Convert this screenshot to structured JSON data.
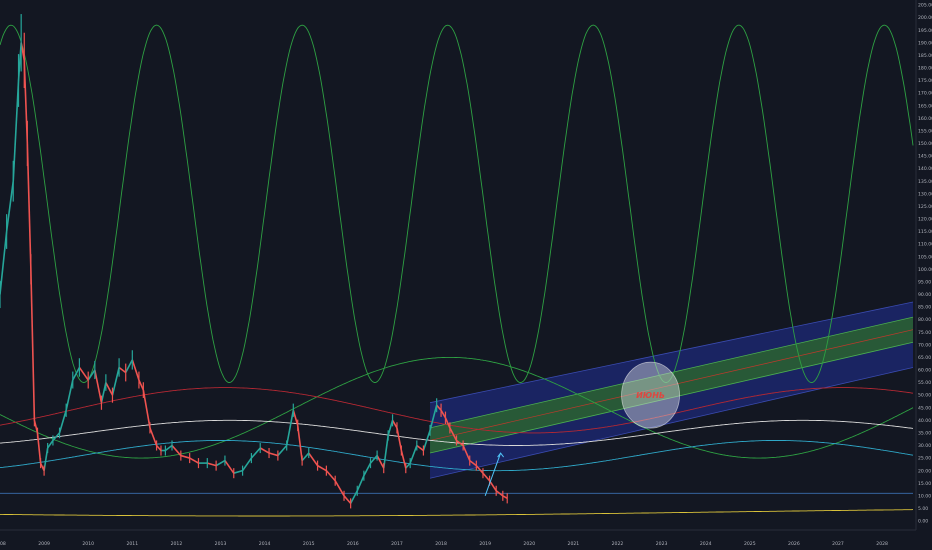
{
  "chart_data": {
    "type": "line",
    "title": "",
    "xlabel": "",
    "ylabel": "",
    "xlim": [
      2008.0,
      2028.7
    ],
    "ylim": [
      0,
      205
    ],
    "grid": false,
    "legend": "none",
    "x_ticks": [
      "2008",
      "2009",
      "2010",
      "2011",
      "2012",
      "2013",
      "2014",
      "2015",
      "2016",
      "2017",
      "2018",
      "2019",
      "2020",
      "2021",
      "2022",
      "2023",
      "2024",
      "2025",
      "2026",
      "2027",
      "2028"
    ],
    "y_ticks": [
      "0.00",
      "5.00",
      "10.00",
      "15.00",
      "20.00",
      "25.00",
      "30.00",
      "35.00",
      "40.00",
      "45.00",
      "50.00",
      "55.00",
      "60.00",
      "65.00",
      "70.00",
      "75.00",
      "80.00",
      "85.00",
      "90.00",
      "95.00",
      "100.00",
      "105.00",
      "110.00",
      "115.00",
      "120.00",
      "125.00",
      "130.00",
      "135.00",
      "140.00",
      "145.00",
      "150.00",
      "155.00",
      "160.00",
      "165.00",
      "170.00",
      "175.00",
      "180.00",
      "185.00",
      "190.00",
      "195.00",
      "200.00",
      "205.00"
    ],
    "price_series": {
      "x": [
        2008.0,
        2008.15,
        2008.3,
        2008.42,
        2008.48,
        2008.55,
        2008.62,
        2008.7,
        2008.78,
        2008.85,
        2008.92,
        2009.0,
        2009.08,
        2009.2,
        2009.35,
        2009.5,
        2009.65,
        2009.8,
        2010.0,
        2010.15,
        2010.3,
        2010.4,
        2010.55,
        2010.7,
        2010.85,
        2011.0,
        2011.15,
        2011.25,
        2011.4,
        2011.55,
        2011.65,
        2011.75,
        2011.9,
        2012.1,
        2012.3,
        2012.5,
        2012.7,
        2012.9,
        2013.1,
        2013.3,
        2013.5,
        2013.7,
        2013.9,
        2014.1,
        2014.3,
        2014.5,
        2014.65,
        2014.75,
        2014.85,
        2015.0,
        2015.2,
        2015.4,
        2015.6,
        2015.8,
        2015.95,
        2016.1,
        2016.25,
        2016.4,
        2016.55,
        2016.7,
        2016.8,
        2016.9,
        2017.0,
        2017.1,
        2017.2,
        2017.3,
        2017.45,
        2017.6,
        2017.75,
        2017.9,
        2018.0,
        2018.1,
        2018.2,
        2018.35,
        2018.5,
        2018.65,
        2018.8,
        2018.95,
        2019.1,
        2019.25,
        2019.4,
        2019.5
      ],
      "y": [
        90,
        115,
        135,
        175,
        190,
        183,
        150,
        100,
        40,
        35,
        23,
        20,
        29,
        32,
        35,
        44,
        56,
        61,
        56,
        60,
        47,
        55,
        50,
        61,
        59,
        64,
        56,
        52,
        37,
        30,
        28,
        28,
        30,
        26,
        25,
        23,
        23,
        22,
        24,
        19,
        20,
        25,
        29,
        27,
        26,
        30,
        44,
        38,
        24,
        27,
        22,
        20,
        16,
        10,
        7,
        12,
        18,
        23,
        26,
        21,
        34,
        40,
        37,
        28,
        21,
        23,
        30,
        28,
        36,
        46,
        44,
        41,
        37,
        32,
        30,
        24,
        22,
        19,
        16,
        12,
        10,
        9
      ]
    },
    "projection_arrow": {
      "x": [
        2019.0,
        2019.35
      ],
      "y": [
        10,
        27
      ]
    },
    "curves": [
      {
        "name": "",
        "color": "#2ea043",
        "kind": "sine",
        "mid": 126,
        "amp": 71,
        "period": 3.3,
        "peak_x": 2008.25
      },
      {
        "name": "",
        "color": "#2ea043",
        "kind": "sine",
        "mid": 45,
        "amp": 20,
        "period": 14.0,
        "peak_x": 2018.2
      },
      {
        "name": "",
        "color": "#b22833",
        "kind": "sine",
        "mid": 44,
        "amp": 9,
        "period": 14.0,
        "peak_x": 2013.1
      },
      {
        "name": "",
        "color": "#2fa8c8",
        "kind": "sine",
        "mid": 26,
        "amp": 6,
        "period": 12.6,
        "peak_x": 2013.0
      },
      {
        "name": "",
        "color": "#d8d8d8",
        "kind": "sine",
        "mid": 35,
        "amp": 5,
        "period": 13.0,
        "peak_x": 2013.2
      },
      {
        "name": "",
        "color": "#d9c23a",
        "kind": "sine",
        "mid": 3.5,
        "amp": 1.5,
        "period": 40.0,
        "peak_x": 2034.0
      },
      {
        "name": "",
        "color": "#3a6fb0",
        "kind": "flat",
        "y": 11
      }
    ],
    "channel": {
      "x": [
        2017.75,
        2028.7
      ],
      "outer_top": [
        47,
        87
      ],
      "inner_top": [
        37,
        81
      ],
      "mid": [
        32,
        76
      ],
      "inner_bottom": [
        27,
        71
      ],
      "outer_bottom": [
        17,
        61
      ],
      "outer_color": "#1e2a78",
      "inner_color": "#2e6b2a"
    },
    "annotation": {
      "text": "ИЮНЬ",
      "x": 2022.75,
      "y": 50
    }
  }
}
